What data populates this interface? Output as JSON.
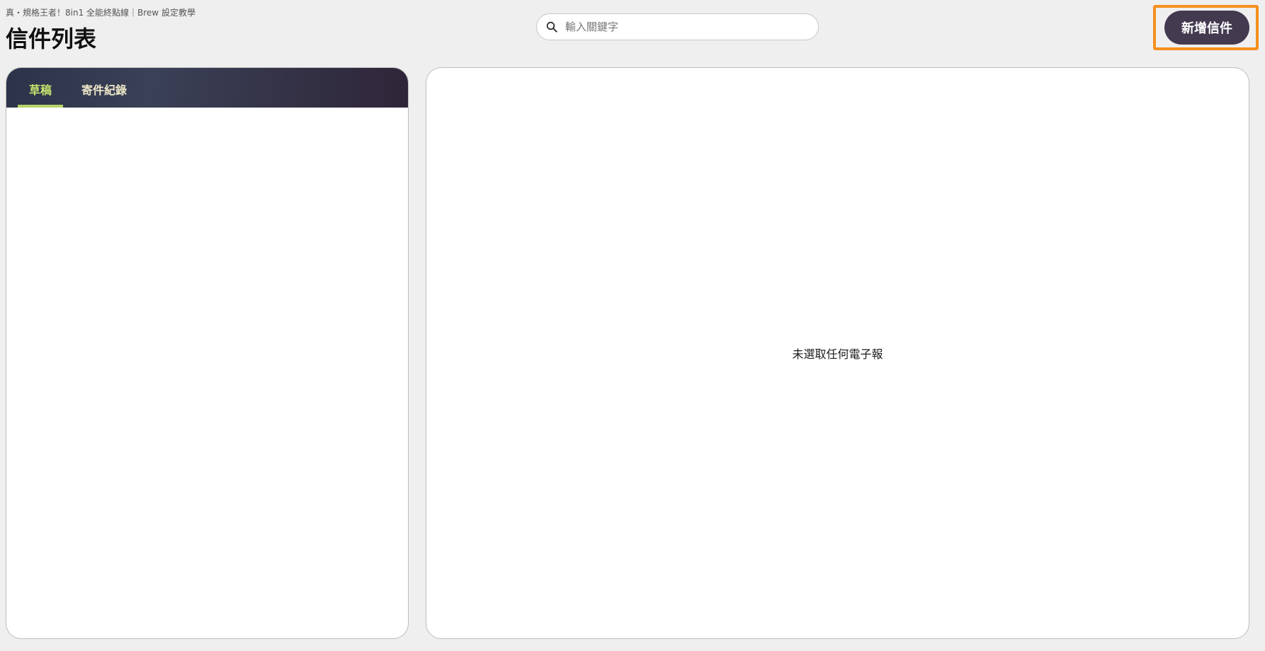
{
  "header": {
    "breadcrumb": "真・規格王者！8in1 全能終點線｜Brew 設定教學",
    "title": "信件列表"
  },
  "search": {
    "placeholder": "輸入關鍵字",
    "value": "",
    "icon": "search-icon"
  },
  "actions": {
    "new_mail_label": "新增信件",
    "new_mail_color": "#443a50",
    "highlight_color": "#f5901e"
  },
  "list_panel": {
    "tabs": [
      {
        "label": "草稿",
        "active": true
      },
      {
        "label": "寄件紀錄",
        "active": false
      }
    ],
    "active_tab_color": "#c6e370"
  },
  "preview_panel": {
    "empty_message": "未選取任何電子報"
  }
}
